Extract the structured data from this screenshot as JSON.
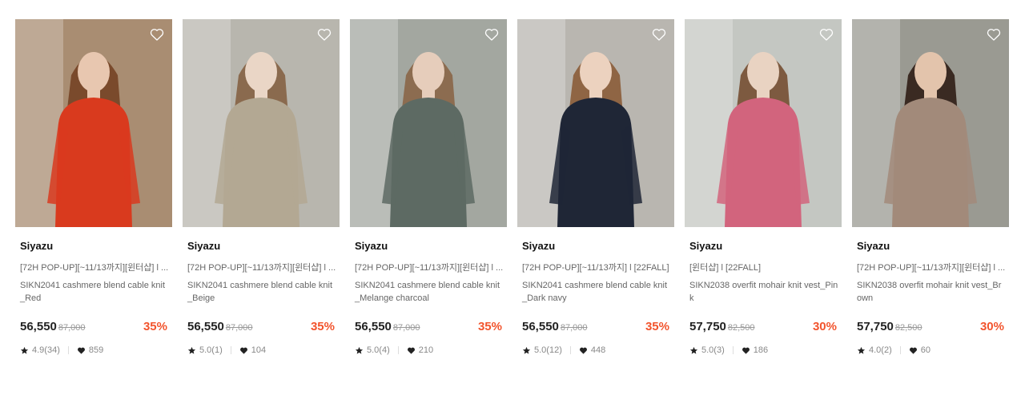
{
  "products": [
    {
      "brand": "Siyazu",
      "promo": "[72H POP-UP][~11/13까지][윈터샵] l ...",
      "name": "SIKN2041 cashmere blend cable knit_Red",
      "price": "56,550",
      "original_price": "87,000",
      "discount": "35%",
      "rating": "4.9(34)",
      "likes": "859",
      "colors": {
        "bg": "#a98d72",
        "garment": "#d93a1e",
        "skin": "#e8c7b0",
        "hair": "#7a4a2c"
      }
    },
    {
      "brand": "Siyazu",
      "promo": "[72H POP-UP][~11/13까지][윈터샵] l ...",
      "name": "SIKN2041 cashmere blend cable knit_Beige",
      "price": "56,550",
      "original_price": "87,000",
      "discount": "35%",
      "rating": "5.0(1)",
      "likes": "104",
      "colors": {
        "bg": "#b8b6ae",
        "garment": "#b3a893",
        "skin": "#ead6c6",
        "hair": "#8a6a4e"
      }
    },
    {
      "brand": "Siyazu",
      "promo": "[72H POP-UP][~11/13까지][윈터샵] l ...",
      "name": "SIKN2041 cashmere blend cable knit_Melange charcoal",
      "price": "56,550",
      "original_price": "87,000",
      "discount": "35%",
      "rating": "5.0(4)",
      "likes": "210",
      "colors": {
        "bg": "#a3a7a0",
        "garment": "#5d6a63",
        "skin": "#e6cdbb",
        "hair": "#8c6c50"
      }
    },
    {
      "brand": "Siyazu",
      "promo": "[72H POP-UP][~11/13까지] l [22FALL]",
      "name": "SIKN2041 cashmere blend cable knit_Dark navy",
      "price": "56,550",
      "original_price": "87,000",
      "discount": "35%",
      "rating": "5.0(12)",
      "likes": "448",
      "colors": {
        "bg": "#b9b6b0",
        "garment": "#1f2636",
        "skin": "#ecd2bf",
        "hair": "#8f6544"
      }
    },
    {
      "brand": "Siyazu",
      "promo": "[윈터샵] l [22FALL]",
      "name": "SIKN2038 overfit mohair knit vest_Pink",
      "price": "57,750",
      "original_price": "82,500",
      "discount": "30%",
      "rating": "5.0(3)",
      "likes": "186",
      "colors": {
        "bg": "#c4c7c2",
        "garment": "#d2647d",
        "skin": "#e9d3c2",
        "hair": "#7d5a40"
      }
    },
    {
      "brand": "Siyazu",
      "promo": "[72H POP-UP][~11/13까지][윈터샵] l ...",
      "name": "SIKN2038 overfit mohair knit vest_Brown",
      "price": "57,750",
      "original_price": "82,500",
      "discount": "30%",
      "rating": "4.0(2)",
      "likes": "60",
      "colors": {
        "bg": "#9a9a92",
        "garment": "#a28a7a",
        "skin": "#e3c4ac",
        "hair": "#3a2a22"
      }
    }
  ],
  "icons": {
    "wishlist": "heart-outline-icon",
    "rating": "star-icon",
    "likes": "heart-icon"
  },
  "accent_discount": "#f2542d"
}
